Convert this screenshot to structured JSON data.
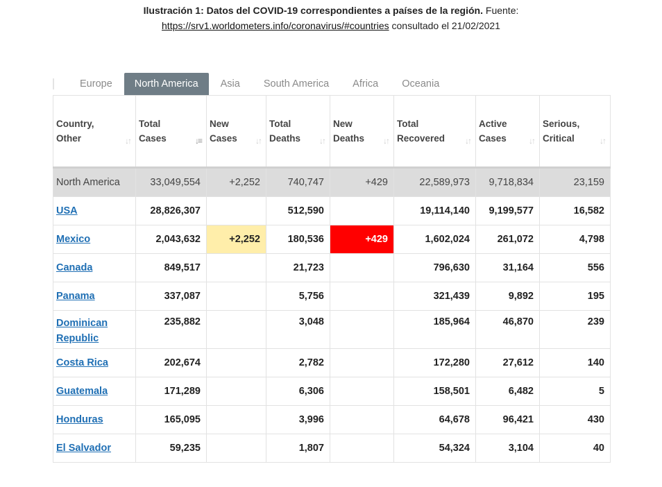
{
  "caption": {
    "bold": "Ilustración  1: Datos del COVID-19 correspondientes  a países de la región.",
    "source_label": "Fuente:",
    "url": "https://srv1.worldometers.info/coronavirus/#countries",
    "consulted": "consultado el 21/02/2021"
  },
  "tabs": [
    "Europe",
    "North America",
    "Asia",
    "South America",
    "Africa",
    "Oceania"
  ],
  "active_tab": "North America",
  "columns": [
    {
      "l1": "Country,",
      "l2": "Other"
    },
    {
      "l1": "Total",
      "l2": "Cases"
    },
    {
      "l1": "New",
      "l2": "Cases"
    },
    {
      "l1": "Total",
      "l2": "Deaths"
    },
    {
      "l1": "New",
      "l2": "Deaths"
    },
    {
      "l1": "Total",
      "l2": "Recovered"
    },
    {
      "l1": "Active",
      "l2": "Cases"
    },
    {
      "l1": "Serious,",
      "l2": "Critical"
    }
  ],
  "total_row": [
    "North America",
    "33,049,554",
    "+2,252",
    "740,747",
    "+429",
    "22,589,973",
    "9,718,834",
    "23,159"
  ],
  "rows": [
    [
      "USA",
      "28,826,307",
      "",
      "512,590",
      "",
      "19,114,140",
      "9,199,577",
      "16,582"
    ],
    [
      "Mexico",
      "2,043,632",
      "+2,252",
      "180,536",
      "+429",
      "1,602,024",
      "261,072",
      "4,798"
    ],
    [
      "Canada",
      "849,517",
      "",
      "21,723",
      "",
      "796,630",
      "31,164",
      "556"
    ],
    [
      "Panama",
      "337,087",
      "",
      "5,756",
      "",
      "321,439",
      "9,892",
      "195"
    ],
    [
      "Dominican Republic",
      "235,882",
      "",
      "3,048",
      "",
      "185,964",
      "46,870",
      "239"
    ],
    [
      "Costa Rica",
      "202,674",
      "",
      "2,782",
      "",
      "172,280",
      "27,612",
      "140"
    ],
    [
      "Guatemala",
      "171,289",
      "",
      "6,306",
      "",
      "158,501",
      "6,482",
      "5"
    ],
    [
      "Honduras",
      "165,095",
      "",
      "3,996",
      "",
      "64,678",
      "96,421",
      "430"
    ],
    [
      "El Salvador",
      "59,235",
      "",
      "1,807",
      "",
      "54,324",
      "3,104",
      "40"
    ]
  ],
  "colors": {
    "tab_active_bg": "#6f7d86",
    "total_row_bg": "#dcdcdc",
    "new_cases_highlight": "#ffeeaa",
    "new_deaths_highlight": "#ff0000",
    "country_link": "#1f6fb4"
  },
  "icons": {
    "sort": "sort-arrows-icon",
    "sort_active": "sort-desc-icon"
  }
}
